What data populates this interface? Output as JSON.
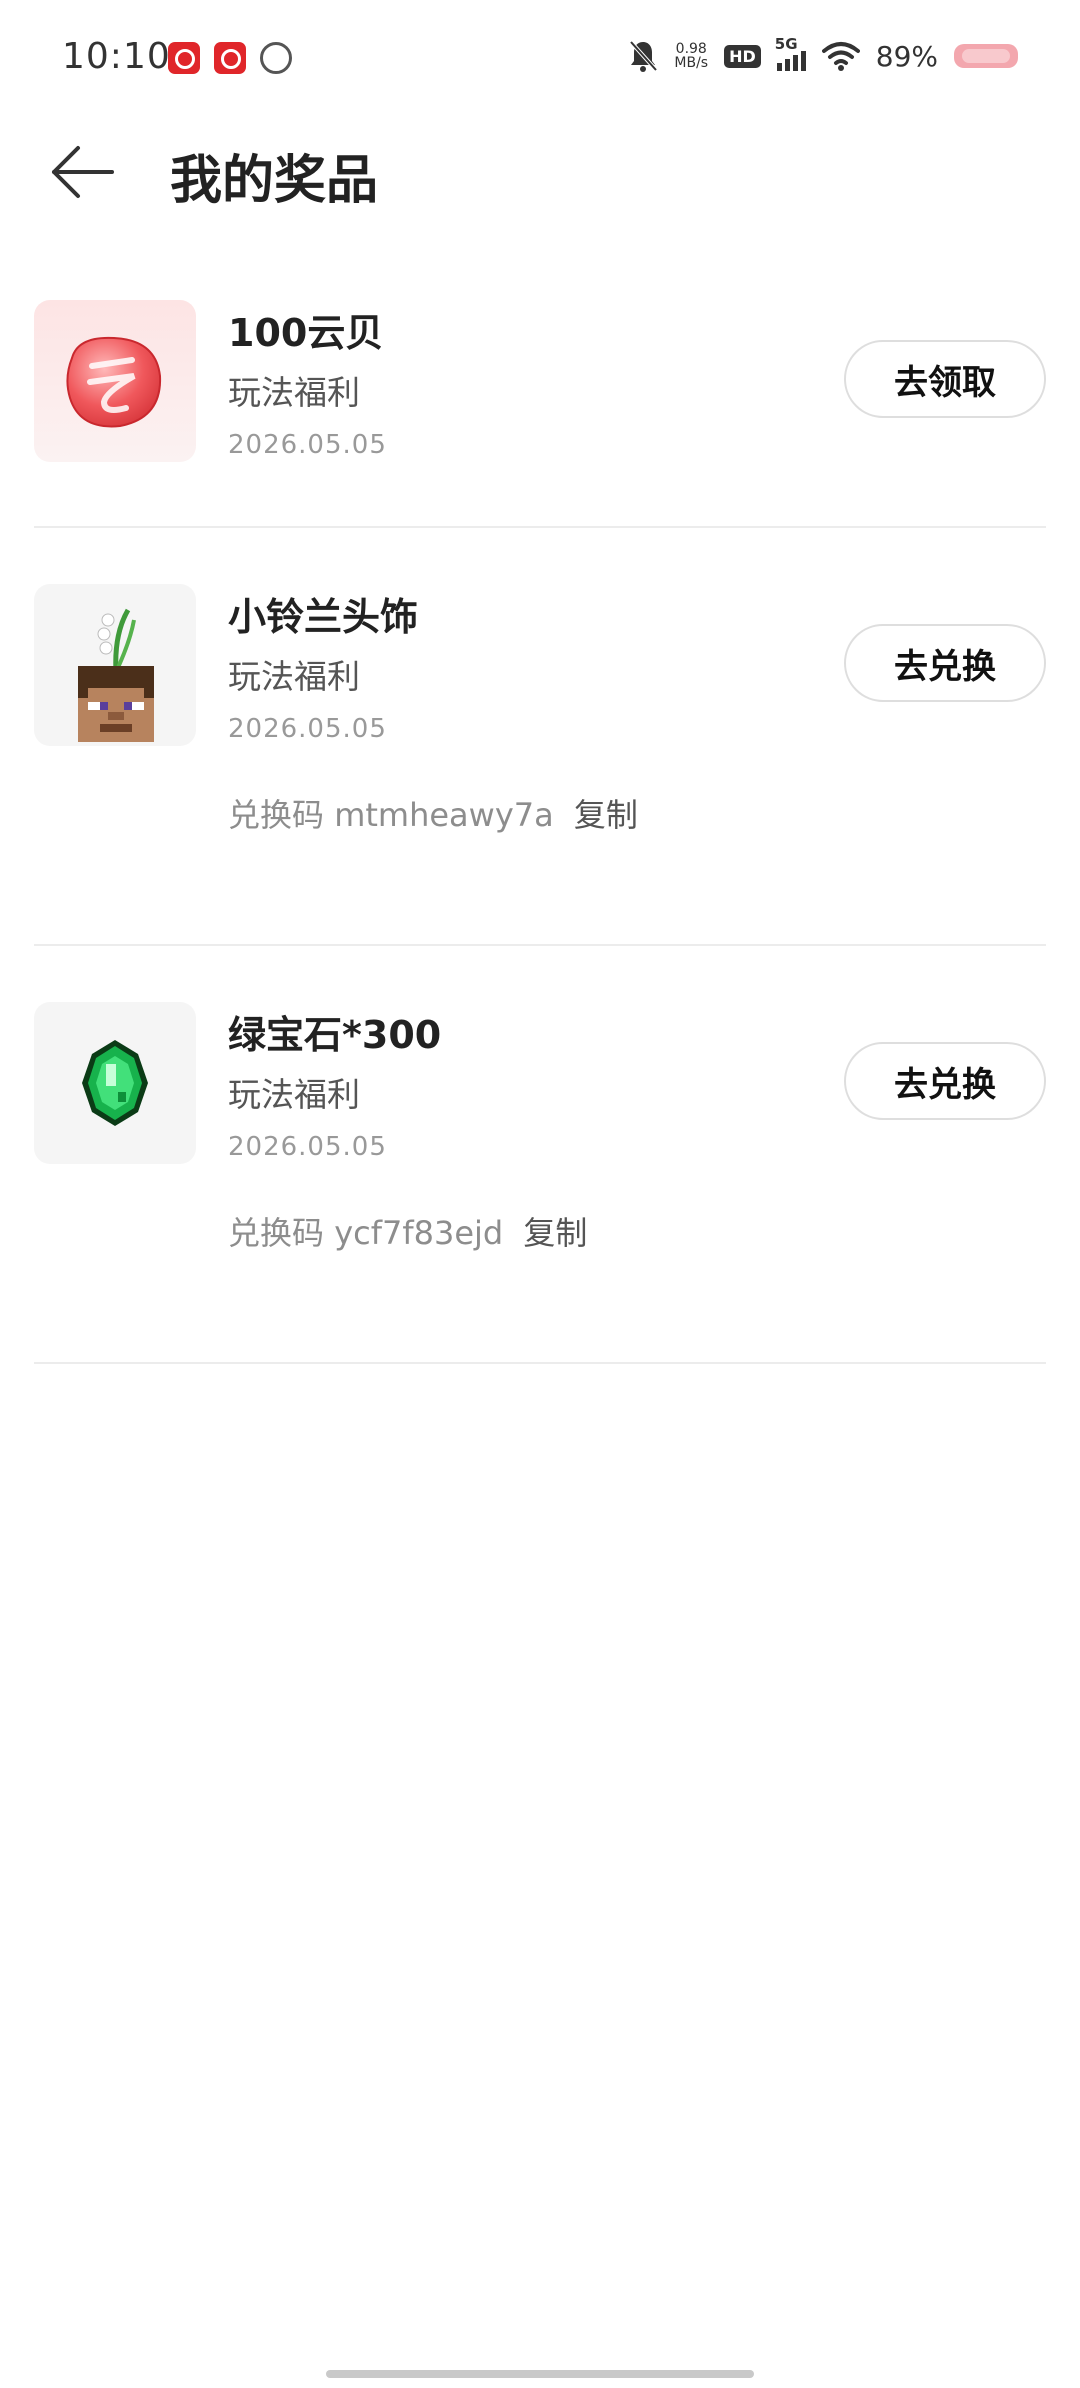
{
  "status_bar": {
    "time": "10:10",
    "speed_value": "0.98",
    "speed_unit": "MB/s",
    "hd_badge": "HD",
    "network": "5G",
    "battery": "89%"
  },
  "header": {
    "title": "我的奖品",
    "back_icon": "arrow-left-icon"
  },
  "prizes": [
    {
      "name": "100云贝",
      "subtitle": "玩法福利",
      "date": "2026.05.05",
      "action": "去领取",
      "icon": "cloud-shell-coin-icon"
    },
    {
      "name": "小铃兰头饰",
      "subtitle": "玩法福利",
      "date": "2026.05.05",
      "action": "去兑换",
      "code_label": "兑换码",
      "code": "mtmheawy7a",
      "copy_label": "复制",
      "icon": "lily-of-valley-headwear-icon"
    },
    {
      "name": "绿宝石*300",
      "subtitle": "玩法福利",
      "date": "2026.05.05",
      "action": "去兑换",
      "code_label": "兑换码",
      "code": "ycf7f83ejd",
      "copy_label": "复制",
      "icon": "emerald-gem-icon"
    }
  ],
  "colors": {
    "background": "#ffffff",
    "divider": "#ececec",
    "button_border": "#dedede",
    "accent_red": "#e0262a",
    "emerald": "#1fbf5f"
  }
}
